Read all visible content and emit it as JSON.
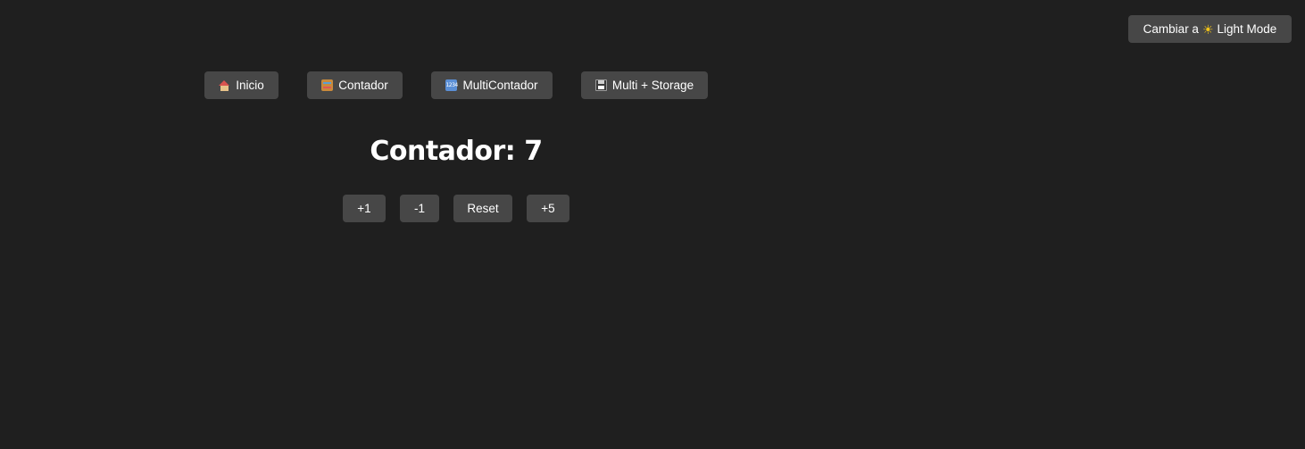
{
  "theme_toggle": {
    "prefix": "Cambiar a",
    "icon": "sun-icon",
    "suffix": "Light Mode"
  },
  "nav": {
    "items": [
      {
        "icon": "house-icon",
        "label": "Inicio"
      },
      {
        "icon": "abacus-icon",
        "label": "Contador"
      },
      {
        "icon": "numbers-icon",
        "icon_text": "1234",
        "label": "MultiContador"
      },
      {
        "icon": "floppy-disk-icon",
        "label": "Multi + Storage"
      }
    ]
  },
  "counter": {
    "title": "Contador: 7",
    "actions": [
      "+1",
      "-1",
      "Reset",
      "+5"
    ]
  },
  "colors": {
    "background": "#1f1f1f",
    "button": "#474747",
    "text": "#ffffff"
  }
}
